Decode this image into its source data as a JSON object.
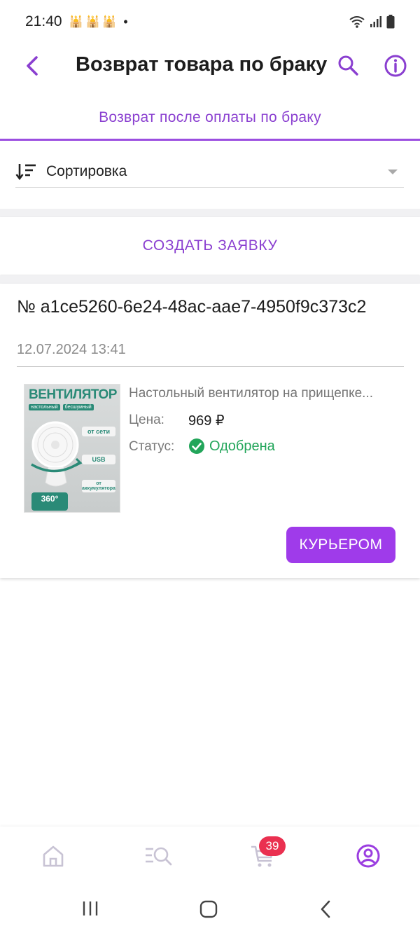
{
  "status_bar": {
    "time": "21:40",
    "notification_icons": "🕌🕌🕌",
    "dot": "•"
  },
  "header": {
    "title": "Возврат товара по браку",
    "icons": [
      "chevron-left-icon",
      "search-icon",
      "info-icon"
    ]
  },
  "tab": {
    "label": "Возврат после оплаты по браку"
  },
  "sort": {
    "label": "Сортировка"
  },
  "create_button": {
    "label": "СОЗДАТЬ ЗАЯВКУ"
  },
  "request": {
    "number": "№ a1ce5260-6e24-48ac-aae7-4950f9c373c2",
    "date": "12.07.2024 13:41",
    "product_name": "Настольный вентилятор на прищепке...",
    "price_label": "Цена:",
    "price_value": "969 ₽",
    "status_label": "Статус:",
    "status_value": "Одобрена",
    "courier_button": "КУРЬЕРОМ",
    "thumbnail": {
      "brand": "ВЕНТИЛЯТОР",
      "tags": [
        "настольный",
        "бесшумный"
      ],
      "features": [
        "от сети",
        "USB",
        "от аккумулятора"
      ],
      "badge": "360°"
    }
  },
  "bottom_nav": {
    "items": [
      "home-icon",
      "catalog-search-icon",
      "cart-icon",
      "profile-icon"
    ],
    "cart_count": "39"
  },
  "colors": {
    "accent": "#9b4ee0",
    "button": "#9f3bea",
    "status_ok": "#22a55a",
    "badge": "#ea3050"
  }
}
